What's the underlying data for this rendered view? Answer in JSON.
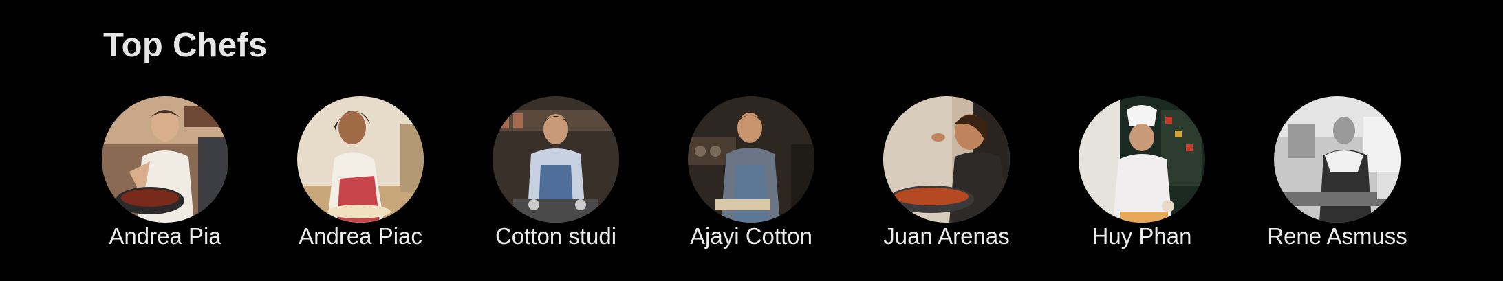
{
  "section": {
    "title": "Top Chefs"
  },
  "chefs": [
    {
      "name": "Andrea Pia",
      "photo": "chef-cooking-pan-photo"
    },
    {
      "name": "Andrea Piac",
      "photo": "chef-kneading-dough-photo"
    },
    {
      "name": "Cotton studi",
      "photo": "chef-plating-kitchen-photo"
    },
    {
      "name": "Ajayi Cotton",
      "photo": "chef-apron-kitchen-photo"
    },
    {
      "name": "Juan Arenas",
      "photo": "chef-tasting-food-photo"
    },
    {
      "name": "Huy Phan",
      "photo": "chef-white-hat-photo"
    },
    {
      "name": "Rene Asmuss",
      "photo": "chef-black-and-white-photo"
    }
  ]
}
